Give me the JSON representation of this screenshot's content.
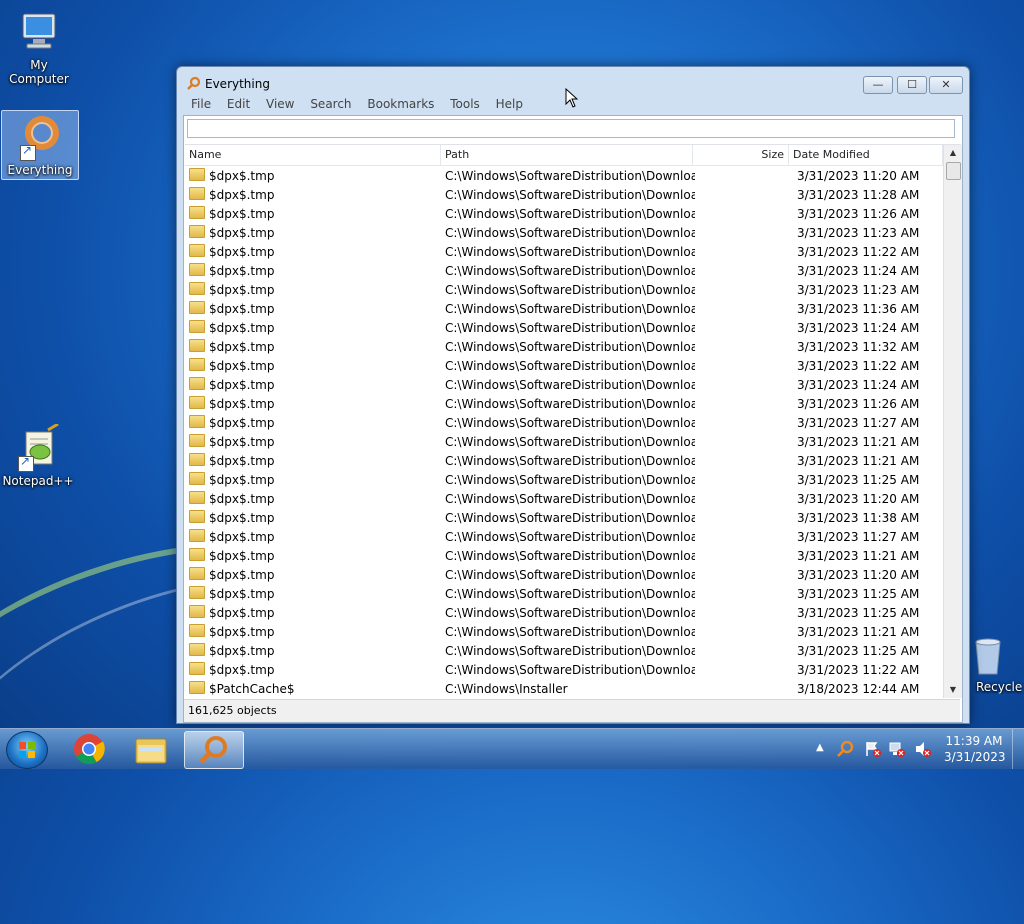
{
  "desktop": {
    "icons": [
      {
        "label": "My Computer"
      },
      {
        "label": "Everything"
      },
      {
        "label": "Notepad++"
      },
      {
        "label": "Recycle Bin"
      }
    ]
  },
  "window": {
    "title": "Everything",
    "controls": {
      "minimize": "—",
      "maximize": "☐",
      "close": "✕"
    },
    "menu": [
      "File",
      "Edit",
      "View",
      "Search",
      "Bookmarks",
      "Tools",
      "Help"
    ],
    "search": {
      "value": "",
      "placeholder": ""
    },
    "columns": {
      "name": "Name",
      "path": "Path",
      "size": "Size",
      "date": "Date Modified"
    },
    "rows": [
      {
        "name": "$dpx$.tmp",
        "path": "C:\\Windows\\SoftwareDistribution\\Download...",
        "size": "",
        "date": "3/31/2023 11:20 AM"
      },
      {
        "name": "$dpx$.tmp",
        "path": "C:\\Windows\\SoftwareDistribution\\Download...",
        "size": "",
        "date": "3/31/2023 11:28 AM"
      },
      {
        "name": "$dpx$.tmp",
        "path": "C:\\Windows\\SoftwareDistribution\\Download...",
        "size": "",
        "date": "3/31/2023 11:26 AM"
      },
      {
        "name": "$dpx$.tmp",
        "path": "C:\\Windows\\SoftwareDistribution\\Download...",
        "size": "",
        "date": "3/31/2023 11:23 AM"
      },
      {
        "name": "$dpx$.tmp",
        "path": "C:\\Windows\\SoftwareDistribution\\Download...",
        "size": "",
        "date": "3/31/2023 11:22 AM"
      },
      {
        "name": "$dpx$.tmp",
        "path": "C:\\Windows\\SoftwareDistribution\\Download...",
        "size": "",
        "date": "3/31/2023 11:24 AM"
      },
      {
        "name": "$dpx$.tmp",
        "path": "C:\\Windows\\SoftwareDistribution\\Download...",
        "size": "",
        "date": "3/31/2023 11:23 AM"
      },
      {
        "name": "$dpx$.tmp",
        "path": "C:\\Windows\\SoftwareDistribution\\Download...",
        "size": "",
        "date": "3/31/2023 11:36 AM"
      },
      {
        "name": "$dpx$.tmp",
        "path": "C:\\Windows\\SoftwareDistribution\\Download...",
        "size": "",
        "date": "3/31/2023 11:24 AM"
      },
      {
        "name": "$dpx$.tmp",
        "path": "C:\\Windows\\SoftwareDistribution\\Download...",
        "size": "",
        "date": "3/31/2023 11:32 AM"
      },
      {
        "name": "$dpx$.tmp",
        "path": "C:\\Windows\\SoftwareDistribution\\Download...",
        "size": "",
        "date": "3/31/2023 11:22 AM"
      },
      {
        "name": "$dpx$.tmp",
        "path": "C:\\Windows\\SoftwareDistribution\\Download...",
        "size": "",
        "date": "3/31/2023 11:24 AM"
      },
      {
        "name": "$dpx$.tmp",
        "path": "C:\\Windows\\SoftwareDistribution\\Download...",
        "size": "",
        "date": "3/31/2023 11:26 AM"
      },
      {
        "name": "$dpx$.tmp",
        "path": "C:\\Windows\\SoftwareDistribution\\Download...",
        "size": "",
        "date": "3/31/2023 11:27 AM"
      },
      {
        "name": "$dpx$.tmp",
        "path": "C:\\Windows\\SoftwareDistribution\\Download...",
        "size": "",
        "date": "3/31/2023 11:21 AM"
      },
      {
        "name": "$dpx$.tmp",
        "path": "C:\\Windows\\SoftwareDistribution\\Download...",
        "size": "",
        "date": "3/31/2023 11:21 AM"
      },
      {
        "name": "$dpx$.tmp",
        "path": "C:\\Windows\\SoftwareDistribution\\Download...",
        "size": "",
        "date": "3/31/2023 11:25 AM"
      },
      {
        "name": "$dpx$.tmp",
        "path": "C:\\Windows\\SoftwareDistribution\\Download...",
        "size": "",
        "date": "3/31/2023 11:20 AM"
      },
      {
        "name": "$dpx$.tmp",
        "path": "C:\\Windows\\SoftwareDistribution\\Download...",
        "size": "",
        "date": "3/31/2023 11:38 AM"
      },
      {
        "name": "$dpx$.tmp",
        "path": "C:\\Windows\\SoftwareDistribution\\Download...",
        "size": "",
        "date": "3/31/2023 11:27 AM"
      },
      {
        "name": "$dpx$.tmp",
        "path": "C:\\Windows\\SoftwareDistribution\\Download...",
        "size": "",
        "date": "3/31/2023 11:21 AM"
      },
      {
        "name": "$dpx$.tmp",
        "path": "C:\\Windows\\SoftwareDistribution\\Download...",
        "size": "",
        "date": "3/31/2023 11:20 AM"
      },
      {
        "name": "$dpx$.tmp",
        "path": "C:\\Windows\\SoftwareDistribution\\Download...",
        "size": "",
        "date": "3/31/2023 11:25 AM"
      },
      {
        "name": "$dpx$.tmp",
        "path": "C:\\Windows\\SoftwareDistribution\\Download...",
        "size": "",
        "date": "3/31/2023 11:25 AM"
      },
      {
        "name": "$dpx$.tmp",
        "path": "C:\\Windows\\SoftwareDistribution\\Download...",
        "size": "",
        "date": "3/31/2023 11:21 AM"
      },
      {
        "name": "$dpx$.tmp",
        "path": "C:\\Windows\\SoftwareDistribution\\Download...",
        "size": "",
        "date": "3/31/2023 11:25 AM"
      },
      {
        "name": "$dpx$.tmp",
        "path": "C:\\Windows\\SoftwareDistribution\\Download...",
        "size": "",
        "date": "3/31/2023 11:22 AM"
      },
      {
        "name": "$PatchCache$",
        "path": "C:\\Windows\\Installer",
        "size": "",
        "date": "3/18/2023 12:44 AM"
      }
    ],
    "status": "161,625 objects"
  },
  "taskbar": {
    "apps": [
      {
        "name": "Start"
      },
      {
        "name": "Google Chrome"
      },
      {
        "name": "Windows Explorer"
      },
      {
        "name": "Everything"
      }
    ],
    "clock": {
      "time": "11:39 AM",
      "date": "3/31/2023"
    }
  }
}
